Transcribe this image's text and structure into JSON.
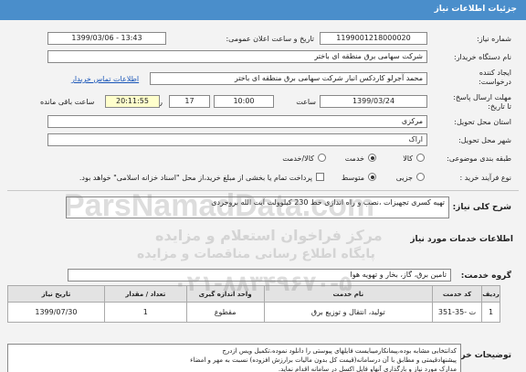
{
  "header": {
    "title": "جزئیات اطلاعات نیاز"
  },
  "form": {
    "need_number_label": "شماره نیاز:",
    "need_number": "1199001218000020",
    "announce_label": "تاریخ و ساعت اعلان عمومی:",
    "announce_value": "1399/03/06 - 13:43",
    "buyer_label": "نام دستگاه خریدار:",
    "buyer_value": "شرکت سهامی برق منطقه ای باختر",
    "creator_label": "ایجاد کننده درخواست:",
    "creator_value": "محمد آجرلو کاردکس انبار شرکت سهامی برق منطقه ای باختر",
    "contact_link": "اطلاعات تماس خریدار",
    "deadline_label": "مهلت ارسال پاسخ: تا تاریخ:",
    "deadline_date": "1399/03/24",
    "time_label": "ساعت",
    "deadline_time": "10:00",
    "days_value": "17",
    "days_label": "روز و",
    "remaining_time": "20:11:55",
    "remaining_label": "ساعت باقی مانده",
    "province_label": "استان محل تحویل:",
    "province_value": "مرکزی",
    "city_label": "شهر محل تحویل:",
    "city_value": "اراک",
    "category_label": "طبقه بندی موضوعی:",
    "category_options": [
      "کالا",
      "خدمت",
      "کالا/خدمت"
    ],
    "category_selected": "خدمت",
    "process_label": "نوع فرآیند خرید :",
    "process_options": [
      "جزیی",
      "متوسط"
    ],
    "process_selected": "متوسط",
    "payment_note": "پرداخت تمام یا بخشی از مبلغ خرید،از محل \"اسناد خزانه اسلامی\" خواهد بود."
  },
  "summary": {
    "label": "شرح کلی نیاز:",
    "value": "تهیه کسری تجهیزات ،نصب و راه اندازی خط 230 کیلوولت آیت الله بروجردی"
  },
  "services": {
    "section_title": "اطلاعات خدمات مورد نیاز",
    "group_label": "گروه خدمت:",
    "group_value": "تامین برق، گاز، بخار و تهویه هوا",
    "columns": [
      "ردیف",
      "کد خدمت",
      "نام خدمت",
      "واحد اندازه گیری",
      "تعداد / مقدار",
      "تاریخ نیاز"
    ],
    "rows": [
      [
        "1",
        "ت -35-351",
        "تولید، انتقال و توزیع برق",
        "مقطوع",
        "1",
        "1399/07/30"
      ]
    ]
  },
  "buyer_notes": {
    "label": "توضیحات خریدار:",
    "text": "کدانتخابی مشابه بوده،پیمانکارمیبایست فایلهای پیوستی را دانلود نموده،تکمیل ویس ازدرج\nپیشنهادقیمتی و مطابق با آن درسامانه(قیمت کل بدون مالیات برارزش افزوده) نسبت به مهر و امضاء\nمدارک مورد نیاز و بارگذاری آنهاو فایل اکسل در سامانه اقدام نماید."
  },
  "watermark": {
    "site": "ParsNamadData.com",
    "slogan": "مرکز فراخوان استعلام و مزایده",
    "slogan2": "پایگاه اطلاع رسانی مناقصات و مزایده",
    "phone": "۰۲۱-۸۸۳۴۹۶۷۰-۵"
  },
  "colors": {
    "accent": "#4a8ecb",
    "link": "#1a56b8",
    "time_bg": "#ffffcc"
  }
}
